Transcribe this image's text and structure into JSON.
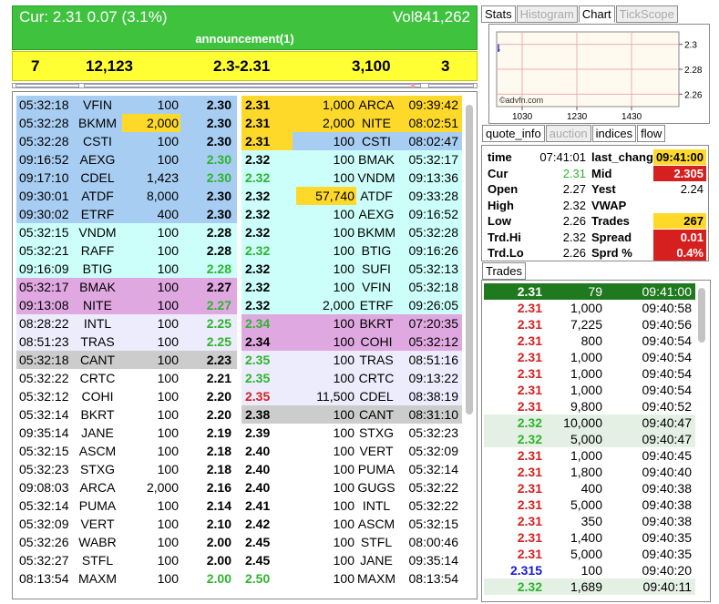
{
  "header": {
    "cur": "Cur: 2.31  0.07  (3.1%)",
    "vol": "Vol841,262",
    "announcement": "announcement(1)"
  },
  "summary": {
    "bid_count": "7",
    "bid_size": "12,123",
    "range": "2.3-2.31",
    "ask_size": "3,100",
    "ask_count": "3"
  },
  "colors": {
    "blue": "#a8cdf2",
    "cyan": "#ccfffa",
    "pink": "#e0a8e0",
    "lavender": "#ececfc",
    "gray": "#cccccc",
    "white": "#ffffff",
    "yellow": "#ffd92a",
    "green": "#2db52d",
    "red": "#d62020",
    "indigo": "#1a1ad6"
  },
  "bids": [
    {
      "time": "05:32:18",
      "mmid": "VFIN",
      "size": "100",
      "price": "2.30",
      "bg": "blue",
      "pc": "",
      "sc": ""
    },
    {
      "time": "05:32:28",
      "mmid": "BKMM",
      "size": "2,000",
      "price": "2.30",
      "bg": "blue",
      "pc": "",
      "sc": "yellow"
    },
    {
      "time": "05:32:28",
      "mmid": "CSTI",
      "size": "100",
      "price": "2.30",
      "bg": "blue",
      "pc": "",
      "sc": ""
    },
    {
      "time": "09:16:52",
      "mmid": "AEXG",
      "size": "100",
      "price": "2.30",
      "bg": "blue",
      "pc": "green",
      "sc": ""
    },
    {
      "time": "09:17:10",
      "mmid": "CDEL",
      "size": "1,423",
      "price": "2.30",
      "bg": "blue",
      "pc": "green",
      "sc": ""
    },
    {
      "time": "09:30:01",
      "mmid": "ATDF",
      "size": "8,000",
      "price": "2.30",
      "bg": "blue",
      "pc": "",
      "sc": ""
    },
    {
      "time": "09:30:02",
      "mmid": "ETRF",
      "size": "400",
      "price": "2.30",
      "bg": "blue",
      "pc": "",
      "sc": ""
    },
    {
      "time": "05:32:15",
      "mmid": "VNDM",
      "size": "100",
      "price": "2.28",
      "bg": "cyan",
      "pc": "",
      "sc": ""
    },
    {
      "time": "05:32:21",
      "mmid": "RAFF",
      "size": "100",
      "price": "2.28",
      "bg": "cyan",
      "pc": "",
      "sc": ""
    },
    {
      "time": "09:16:09",
      "mmid": "BTIG",
      "size": "100",
      "price": "2.28",
      "bg": "cyan",
      "pc": "green",
      "sc": ""
    },
    {
      "time": "05:32:17",
      "mmid": "BMAK",
      "size": "100",
      "price": "2.27",
      "bg": "pink",
      "pc": "",
      "sc": ""
    },
    {
      "time": "09:13:08",
      "mmid": "NITE",
      "size": "100",
      "price": "2.27",
      "bg": "pink",
      "pc": "green",
      "sc": ""
    },
    {
      "time": "08:28:22",
      "mmid": "INTL",
      "size": "100",
      "price": "2.25",
      "bg": "lavender",
      "pc": "green",
      "sc": ""
    },
    {
      "time": "08:51:23",
      "mmid": "TRAS",
      "size": "100",
      "price": "2.25",
      "bg": "lavender",
      "pc": "green",
      "sc": ""
    },
    {
      "time": "05:32:18",
      "mmid": "CANT",
      "size": "100",
      "price": "2.23",
      "bg": "gray",
      "pc": "",
      "sc": ""
    },
    {
      "time": "05:32:22",
      "mmid": "CRTC",
      "size": "100",
      "price": "2.21",
      "bg": "white",
      "pc": "",
      "sc": ""
    },
    {
      "time": "05:32:12",
      "mmid": "COHI",
      "size": "100",
      "price": "2.20",
      "bg": "white",
      "pc": "",
      "sc": ""
    },
    {
      "time": "05:32:14",
      "mmid": "BKRT",
      "size": "100",
      "price": "2.20",
      "bg": "white",
      "pc": "",
      "sc": ""
    },
    {
      "time": "09:35:14",
      "mmid": "JANE",
      "size": "100",
      "price": "2.19",
      "bg": "white",
      "pc": "",
      "sc": ""
    },
    {
      "time": "05:32:15",
      "mmid": "ASCM",
      "size": "100",
      "price": "2.18",
      "bg": "white",
      "pc": "",
      "sc": ""
    },
    {
      "time": "05:32:23",
      "mmid": "STXG",
      "size": "100",
      "price": "2.18",
      "bg": "white",
      "pc": "",
      "sc": ""
    },
    {
      "time": "09:08:03",
      "mmid": "ARCA",
      "size": "2,000",
      "price": "2.16",
      "bg": "white",
      "pc": "",
      "sc": ""
    },
    {
      "time": "05:32:14",
      "mmid": "PUMA",
      "size": "100",
      "price": "2.14",
      "bg": "white",
      "pc": "",
      "sc": ""
    },
    {
      "time": "05:32:09",
      "mmid": "VERT",
      "size": "100",
      "price": "2.10",
      "bg": "white",
      "pc": "",
      "sc": ""
    },
    {
      "time": "05:32:26",
      "mmid": "WABR",
      "size": "100",
      "price": "2.00",
      "bg": "white",
      "pc": "",
      "sc": ""
    },
    {
      "time": "05:32:27",
      "mmid": "STFL",
      "size": "100",
      "price": "2.00",
      "bg": "white",
      "pc": "",
      "sc": ""
    },
    {
      "time": "08:13:54",
      "mmid": "MAXM",
      "size": "100",
      "price": "2.00",
      "bg": "white",
      "pc": "green",
      "sc": ""
    }
  ],
  "asks": [
    {
      "price": "2.31",
      "size": "1,000",
      "mmid": "ARCA",
      "time": "09:39:42",
      "bg": "yellow",
      "pc": "",
      "sc": ""
    },
    {
      "price": "2.31",
      "size": "2,000",
      "mmid": "NITE",
      "time": "08:02:51",
      "bg": "yellow",
      "pc": "",
      "sc": ""
    },
    {
      "price": "2.31",
      "size": "100",
      "mmid": "CSTI",
      "time": "08:02:47",
      "bg": "blue",
      "pc": "",
      "sc": "",
      "pbg": "yellow"
    },
    {
      "price": "2.32",
      "size": "100",
      "mmid": "BMAK",
      "time": "05:32:17",
      "bg": "cyan",
      "pc": "",
      "sc": ""
    },
    {
      "price": "2.32",
      "size": "100",
      "mmid": "VNDM",
      "time": "09:13:36",
      "bg": "cyan",
      "pc": "green",
      "sc": ""
    },
    {
      "price": "2.32",
      "size": "57,740",
      "mmid": "ATDF",
      "time": "09:33:28",
      "bg": "cyan",
      "pc": "",
      "sc": "yellow"
    },
    {
      "price": "2.32",
      "size": "100",
      "mmid": "AEXG",
      "time": "09:16:52",
      "bg": "cyan",
      "pc": "",
      "sc": ""
    },
    {
      "price": "2.32",
      "size": "100",
      "mmid": "BKMM",
      "time": "05:32:28",
      "bg": "cyan",
      "pc": "",
      "sc": ""
    },
    {
      "price": "2.32",
      "size": "100",
      "mmid": "BTIG",
      "time": "09:16:26",
      "bg": "cyan",
      "pc": "green",
      "sc": ""
    },
    {
      "price": "2.32",
      "size": "100",
      "mmid": "SUFI",
      "time": "05:32:13",
      "bg": "cyan",
      "pc": "",
      "sc": ""
    },
    {
      "price": "2.32",
      "size": "100",
      "mmid": "VFIN",
      "time": "05:32:18",
      "bg": "cyan",
      "pc": "",
      "sc": ""
    },
    {
      "price": "2.32",
      "size": "2,000",
      "mmid": "ETRF",
      "time": "09:26:05",
      "bg": "cyan",
      "pc": "",
      "sc": ""
    },
    {
      "price": "2.34",
      "size": "100",
      "mmid": "BKRT",
      "time": "07:20:35",
      "bg": "pink",
      "pc": "green",
      "sc": ""
    },
    {
      "price": "2.34",
      "size": "100",
      "mmid": "COHI",
      "time": "05:32:12",
      "bg": "pink",
      "pc": "",
      "sc": ""
    },
    {
      "price": "2.35",
      "size": "100",
      "mmid": "TRAS",
      "time": "08:51:16",
      "bg": "lavender",
      "pc": "green",
      "sc": ""
    },
    {
      "price": "2.35",
      "size": "100",
      "mmid": "CRTC",
      "time": "09:13:22",
      "bg": "lavender",
      "pc": "green",
      "sc": ""
    },
    {
      "price": "2.35",
      "size": "11,500",
      "mmid": "CDEL",
      "time": "08:38:19",
      "bg": "lavender",
      "pc": "red",
      "sc": ""
    },
    {
      "price": "2.38",
      "size": "100",
      "mmid": "CANT",
      "time": "08:31:10",
      "bg": "gray",
      "pc": "",
      "sc": ""
    },
    {
      "price": "2.39",
      "size": "100",
      "mmid": "STXG",
      "time": "05:32:23",
      "bg": "white",
      "pc": "",
      "sc": ""
    },
    {
      "price": "2.40",
      "size": "100",
      "mmid": "VERT",
      "time": "05:32:09",
      "bg": "white",
      "pc": "",
      "sc": ""
    },
    {
      "price": "2.40",
      "size": "100",
      "mmid": "PUMA",
      "time": "05:32:14",
      "bg": "white",
      "pc": "",
      "sc": ""
    },
    {
      "price": "2.40",
      "size": "100",
      "mmid": "GUGS",
      "time": "05:32:22",
      "bg": "white",
      "pc": "",
      "sc": ""
    },
    {
      "price": "2.41",
      "size": "100",
      "mmid": "INTL",
      "time": "05:32:22",
      "bg": "white",
      "pc": "",
      "sc": ""
    },
    {
      "price": "2.42",
      "size": "100",
      "mmid": "ASCM",
      "time": "05:32:15",
      "bg": "white",
      "pc": "",
      "sc": ""
    },
    {
      "price": "2.45",
      "size": "100",
      "mmid": "STFL",
      "time": "08:00:46",
      "bg": "white",
      "pc": "",
      "sc": ""
    },
    {
      "price": "2.45",
      "size": "100",
      "mmid": "JANE",
      "time": "09:35:14",
      "bg": "white",
      "pc": "",
      "sc": ""
    },
    {
      "price": "2.50",
      "size": "100",
      "mmid": "MAXM",
      "time": "08:13:54",
      "bg": "white",
      "pc": "green",
      "sc": ""
    }
  ],
  "top_tabs": [
    "Stats",
    "Histogram",
    "Chart",
    "TickScope"
  ],
  "chart": {
    "watermark": "©advfn.com",
    "x_ticks": [
      "1030",
      "1230",
      "1430"
    ],
    "y_ticks": [
      "2.3",
      "2.28",
      "2.26"
    ],
    "ylim": [
      2.25,
      2.31
    ]
  },
  "quote_tabs": [
    "quote_info",
    "auction",
    "indices",
    "flow"
  ],
  "quote": [
    {
      "l": "time",
      "v": "07:41:01",
      "k": "last_change",
      "w": "09:41:00",
      "wbg": "yellow",
      "vc": ""
    },
    {
      "l": "Cur",
      "v": "2.31",
      "k": "Mid",
      "w": "2.305",
      "wbg": "red",
      "vc": "green"
    },
    {
      "l": "Open",
      "v": "2.27",
      "k": "Yest",
      "w": "2.24",
      "wbg": "",
      "vc": ""
    },
    {
      "l": "High",
      "v": "2.32",
      "k": "VWAP",
      "w": "",
      "wbg": "",
      "vc": ""
    },
    {
      "l": "Low",
      "v": "2.26",
      "k": "Trades",
      "w": "267",
      "wbg": "yellow",
      "vc": ""
    },
    {
      "l": "Trd.Hi",
      "v": "2.32",
      "k": "Spread",
      "w": "0.01",
      "wbg": "red",
      "vc": ""
    },
    {
      "l": "Trd.Lo",
      "v": "2.26",
      "k": "Sprd %",
      "w": "0.4%",
      "wbg": "red",
      "vc": ""
    }
  ],
  "trades_tab": "Trades",
  "trades": [
    {
      "p": "2.31",
      "s": "79",
      "t": "09:41:00",
      "c": "hl"
    },
    {
      "p": "2.31",
      "s": "1,000",
      "t": "09:40:58",
      "c": "red"
    },
    {
      "p": "2.31",
      "s": "7,225",
      "t": "09:40:56",
      "c": "red"
    },
    {
      "p": "2.31",
      "s": "800",
      "t": "09:40:54",
      "c": "red"
    },
    {
      "p": "2.31",
      "s": "1,000",
      "t": "09:40:54",
      "c": "red"
    },
    {
      "p": "2.31",
      "s": "1,000",
      "t": "09:40:54",
      "c": "red"
    },
    {
      "p": "2.31",
      "s": "1,000",
      "t": "09:40:54",
      "c": "red"
    },
    {
      "p": "2.31",
      "s": "9,800",
      "t": "09:40:52",
      "c": "red"
    },
    {
      "p": "2.32",
      "s": "10,000",
      "t": "09:40:47",
      "c": "green"
    },
    {
      "p": "2.32",
      "s": "5,000",
      "t": "09:40:47",
      "c": "green"
    },
    {
      "p": "2.31",
      "s": "1,000",
      "t": "09:40:45",
      "c": "red"
    },
    {
      "p": "2.31",
      "s": "1,800",
      "t": "09:40:40",
      "c": "red"
    },
    {
      "p": "2.31",
      "s": "400",
      "t": "09:40:38",
      "c": "red"
    },
    {
      "p": "2.31",
      "s": "5,000",
      "t": "09:40:38",
      "c": "red"
    },
    {
      "p": "2.31",
      "s": "350",
      "t": "09:40:38",
      "c": "red"
    },
    {
      "p": "2.31",
      "s": "1,400",
      "t": "09:40:35",
      "c": "red"
    },
    {
      "p": "2.31",
      "s": "5,000",
      "t": "09:40:35",
      "c": "red"
    },
    {
      "p": "2.315",
      "s": "100",
      "t": "09:40:20",
      "c": "indigo"
    },
    {
      "p": "2.32",
      "s": "1,689",
      "t": "09:40:11",
      "c": "green"
    }
  ]
}
